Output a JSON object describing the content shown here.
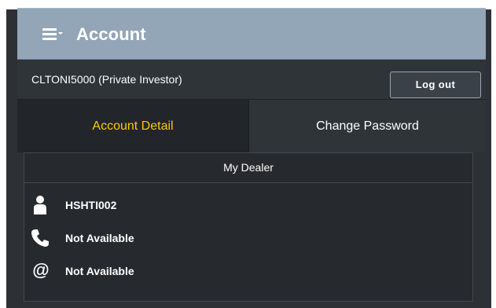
{
  "header": {
    "title": "Account",
    "menu_icon": "hamburger-menu-dropdown-icon"
  },
  "account": {
    "user_label": "CLTONI5000 (Private Investor)",
    "logout_label": "Log out"
  },
  "tabs": [
    {
      "label": "Account Detail",
      "active": true
    },
    {
      "label": "Change Password",
      "active": false
    }
  ],
  "dealer": {
    "title": "My Dealer",
    "rows": [
      {
        "icon": "person-icon",
        "value": "HSHTI002"
      },
      {
        "icon": "phone-icon",
        "value": "Not Available"
      },
      {
        "icon": "email-at-icon",
        "value": "Not Available"
      }
    ]
  },
  "colors": {
    "header_bg": "#93a6b8",
    "panel_bg": "#2d3136",
    "active_tab_text": "#ffc800"
  }
}
